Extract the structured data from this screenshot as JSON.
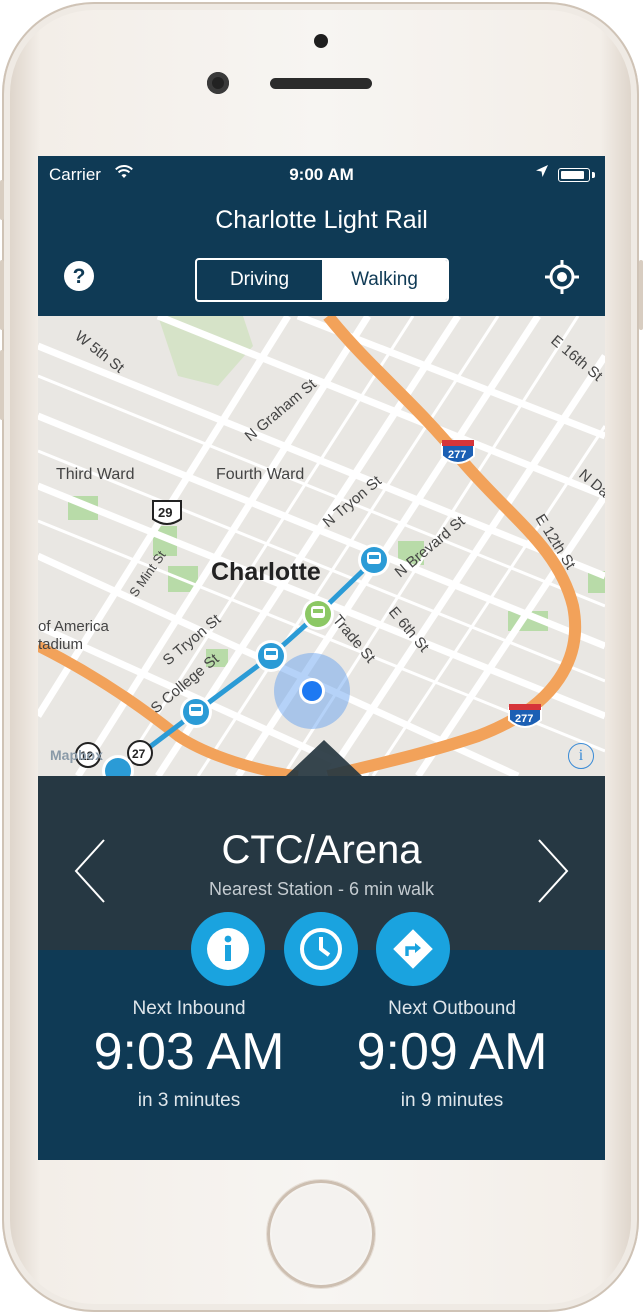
{
  "status_bar": {
    "carrier": "Carrier",
    "time": "9:00 AM"
  },
  "header": {
    "title": "Charlotte Light Rail",
    "help_label": "?",
    "modes": [
      "Driving",
      "Walking"
    ],
    "selected_mode": "Walking"
  },
  "map": {
    "labels": [
      "W 5th St",
      "N Graham St",
      "Third Ward",
      "Fourth Ward",
      "N Tryon St",
      "N Brevard St",
      "E 12th St",
      "E 16th St",
      "N Da",
      "S Mint St",
      "S Tryon St",
      "S College St",
      "Trade St",
      "E 6th St",
      "of America",
      "tadium"
    ],
    "city": "Charlotte",
    "shields": [
      "277",
      "29",
      "277",
      "12",
      "27"
    ],
    "attribution": "Mapbox",
    "info_label": "i"
  },
  "station_panel": {
    "station_name": "CTC/Arena",
    "nearest_text": "Nearest Station - 6 min walk",
    "inbound": {
      "label": "Next Inbound",
      "time": "9:03 AM",
      "eta": "in 3 minutes"
    },
    "outbound": {
      "label": "Next Outbound",
      "time": "9:09 AM",
      "eta": "in 9 minutes"
    },
    "accent_color": "#1aa3df",
    "header_color": "#0f3a55"
  }
}
